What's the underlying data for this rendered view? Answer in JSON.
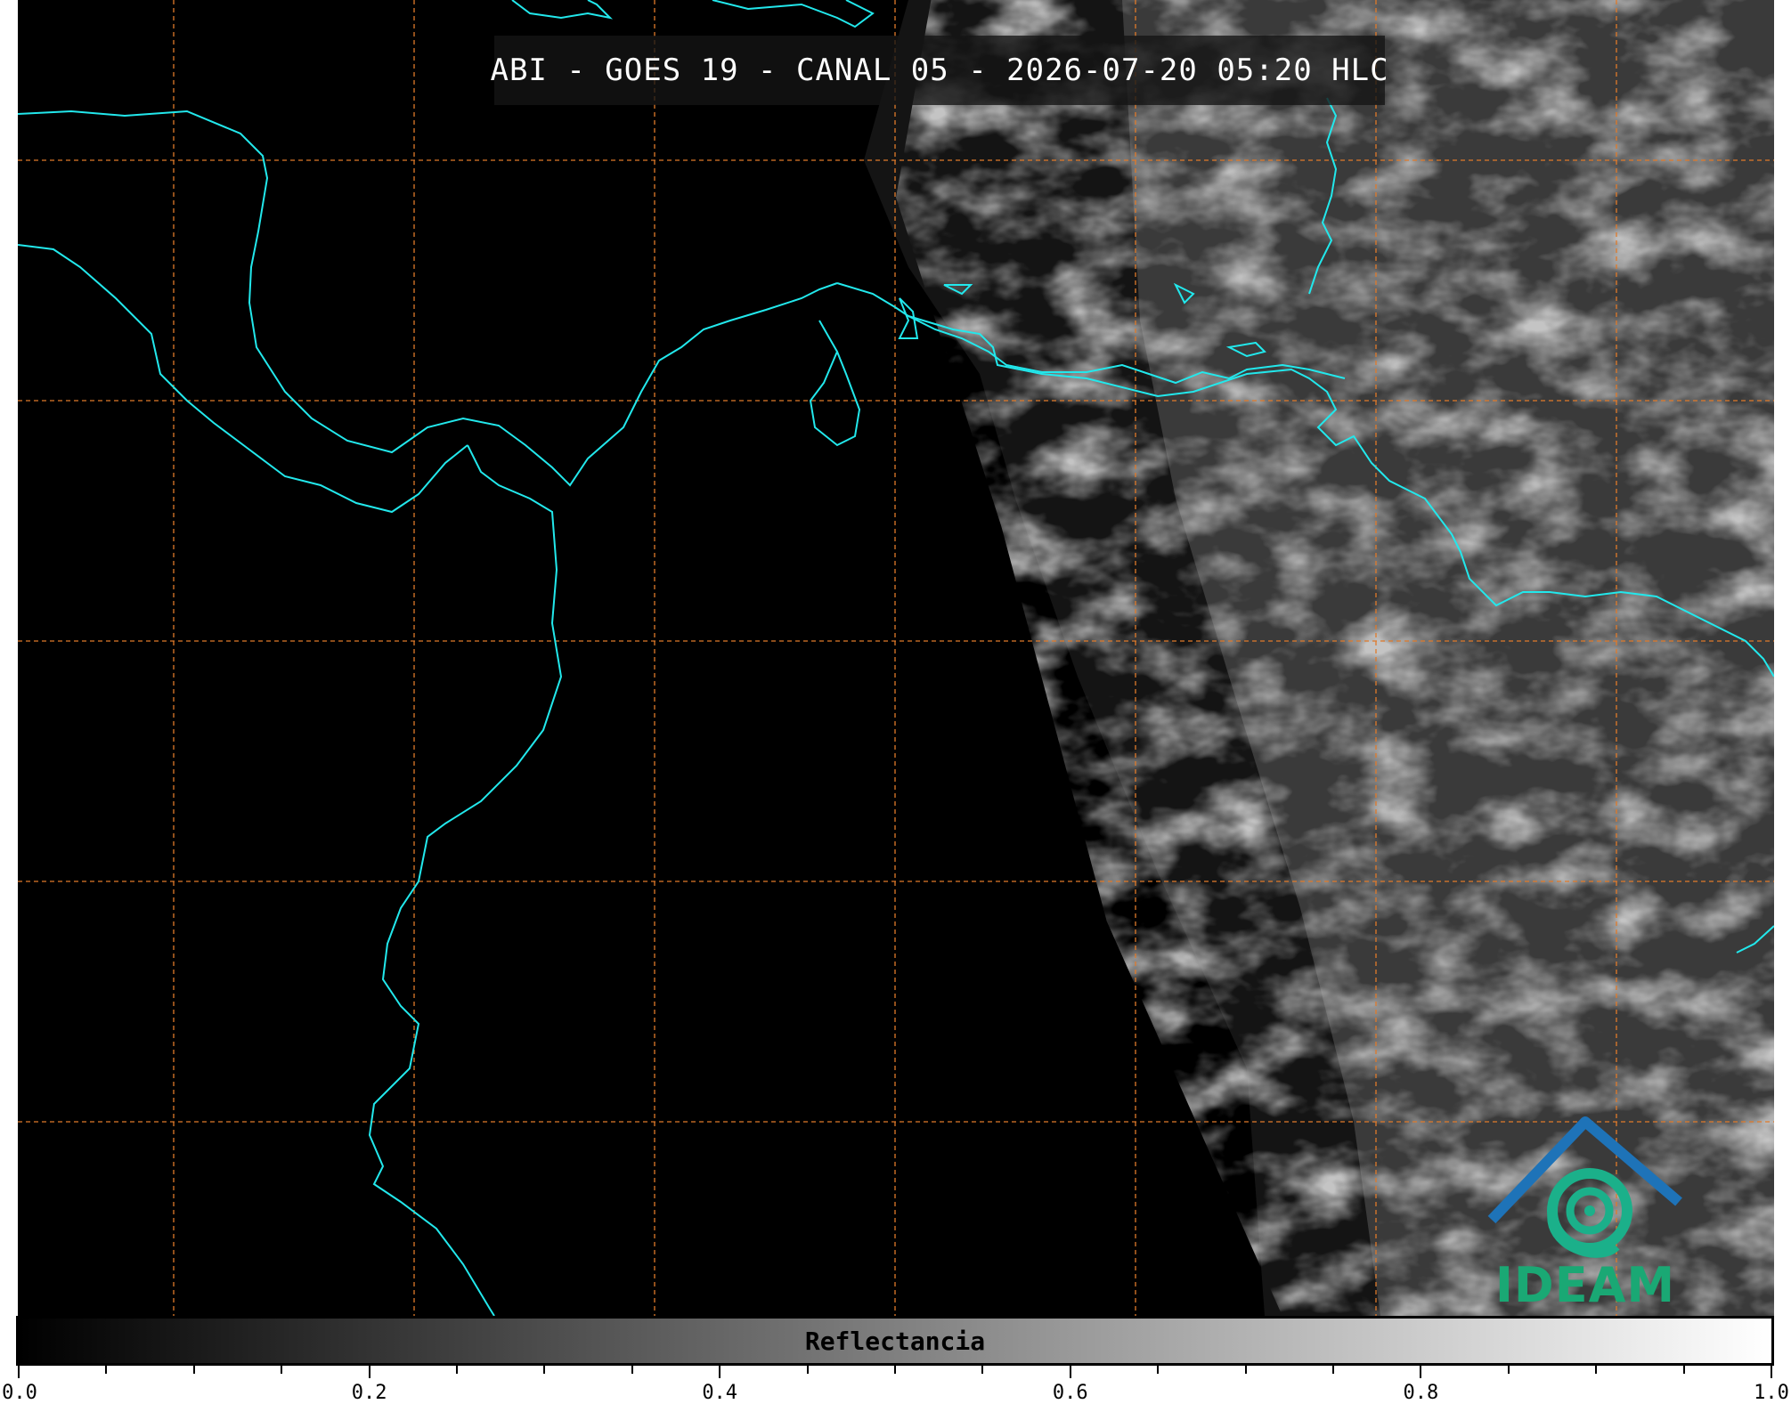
{
  "title": "ABI - GOES 19 - CANAL 05 - 2026-07-20 05:20 HLC",
  "logo": {
    "text": "IDEAM",
    "icon": "ideam-mountain-swirl-icon",
    "colors": {
      "mountain": "#1e73b8",
      "swirl": "#1bb08a",
      "text": "#1aa874"
    }
  },
  "map": {
    "background": "#000000",
    "coastline_color": "#22e8ec",
    "gridline_color": "#e07a2a",
    "gridline_style": "dashed"
  },
  "colorbar": {
    "label": "Reflectancia",
    "range": [
      0.0,
      1.0
    ],
    "colormap": "gray",
    "tick_labels": [
      "0.0",
      "0.2",
      "0.4",
      "0.6",
      "0.8",
      "1.0"
    ],
    "major_ticks": [
      0.0,
      0.2,
      0.4,
      0.6,
      0.8,
      1.0
    ],
    "minor_step": 0.05
  }
}
